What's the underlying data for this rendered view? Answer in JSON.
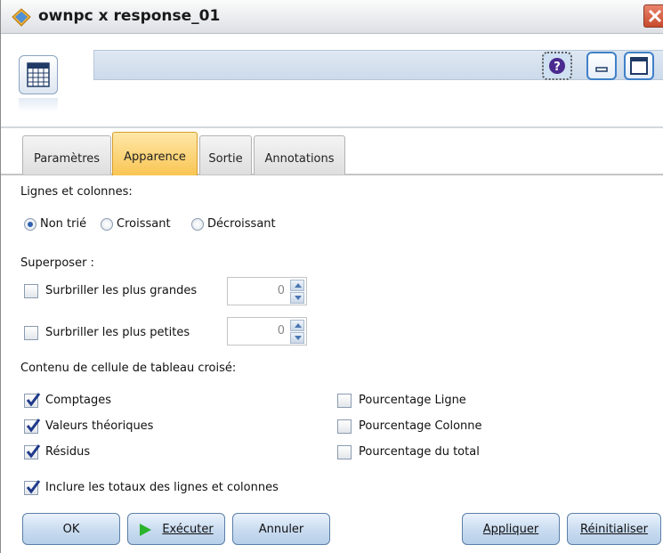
{
  "window": {
    "title": "ownpc x response_01"
  },
  "tabs": [
    {
      "label": "Paramètres"
    },
    {
      "label": "Apparence"
    },
    {
      "label": "Sortie"
    },
    {
      "label": "Annotations"
    }
  ],
  "sorting": {
    "heading": "Lignes et colonnes:",
    "options": [
      "Non trié",
      "Croissant",
      "Décroissant"
    ],
    "selected": "Non trié"
  },
  "overlay": {
    "heading": "Superposer :",
    "highlight_largest": {
      "label": "Surbriller les plus grandes",
      "checked": false,
      "value": "0"
    },
    "highlight_smallest": {
      "label": "Surbriller les plus petites",
      "checked": false,
      "value": "0"
    }
  },
  "cells": {
    "heading": "Contenu de cellule de tableau croisé:",
    "left": [
      {
        "label": "Comptages",
        "checked": true
      },
      {
        "label": "Valeurs théoriques",
        "checked": true
      },
      {
        "label": "Résidus",
        "checked": true
      }
    ],
    "right": [
      {
        "label": "Pourcentage Ligne",
        "checked": false
      },
      {
        "label": "Pourcentage Colonne",
        "checked": false
      },
      {
        "label": "Pourcentage du total",
        "checked": false
      }
    ],
    "totals": {
      "label": "Inclure les totaux des lignes et colonnes",
      "checked": true
    }
  },
  "buttons": {
    "ok": "OK",
    "execute": "Exécuter",
    "cancel": "Annuler",
    "apply": "Appliquer",
    "reset": "Réinitialiser"
  },
  "colors": {
    "active_tab": "#f9c553",
    "accent": "#2f63b0",
    "play_icon": "#2bb32b"
  },
  "icons": {
    "title": "diamond-node-icon",
    "node": "table-node-icon",
    "help": "help-icon",
    "minimize": "minimize-icon",
    "maximize": "maximize-icon",
    "close": "close-icon",
    "execute": "play-icon"
  }
}
